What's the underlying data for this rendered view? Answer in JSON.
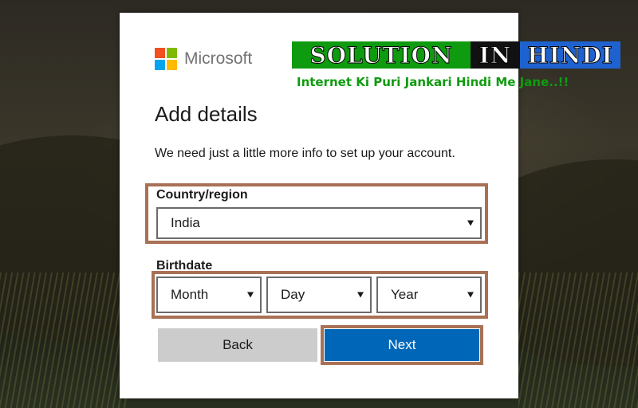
{
  "brand": {
    "name": "Microsoft",
    "colors": [
      "#f25022",
      "#7fba00",
      "#00a4ef",
      "#ffb900"
    ]
  },
  "page": {
    "title": "Add details",
    "intro": "We need just a little more info to set up your account."
  },
  "country": {
    "label": "Country/region",
    "selected": "India"
  },
  "birthdate": {
    "label": "Birthdate",
    "month": "Month",
    "day": "Day",
    "year": "Year"
  },
  "actions": {
    "back_label": "Back",
    "next_label": "Next"
  },
  "watermark": {
    "word1": "SOLUTION",
    "word2": "IN",
    "word3": "HINDI",
    "tagline": "Internet Ki Puri Jankari Hindi Me Jane..!!"
  },
  "colors": {
    "primary_button": "#0067b8",
    "secondary_button": "#cccccc",
    "highlight_border": "#a97055",
    "watermark_green": "#0f9b0f",
    "watermark_blue": "#1e62d0",
    "watermark_black": "#111111"
  }
}
